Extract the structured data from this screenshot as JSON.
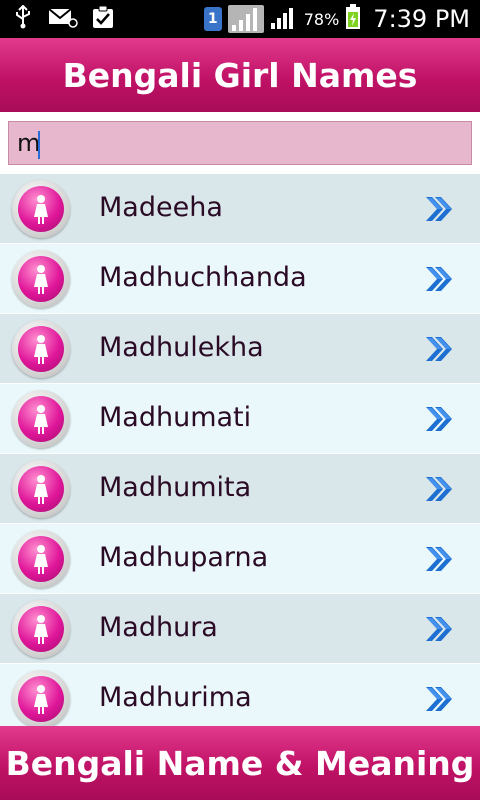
{
  "status_bar": {
    "sim_slot": "1",
    "battery_percent": "78%",
    "time": "7:39 PM",
    "icons": [
      "usb-icon",
      "email-icon",
      "clipboard-check-icon",
      "sim-icon",
      "signal-icon",
      "battery-charging-icon"
    ]
  },
  "header": {
    "title": "Bengali Girl Names"
  },
  "search": {
    "value": "m"
  },
  "names": [
    {
      "label": "Madeeha"
    },
    {
      "label": "Madhuchhanda"
    },
    {
      "label": "Madhulekha"
    },
    {
      "label": "Madhumati"
    },
    {
      "label": "Madhumita"
    },
    {
      "label": "Madhuparna"
    },
    {
      "label": "Madhura"
    },
    {
      "label": "Madhurima"
    }
  ],
  "footer": {
    "title": "Bengali Name & Meaning"
  },
  "colors": {
    "accent": "#c01266",
    "row_odd": "#d9e6ea",
    "row_even": "#eaf8fb",
    "search_bg": "#e6b7cd",
    "chevron": "#1d6fd1"
  }
}
